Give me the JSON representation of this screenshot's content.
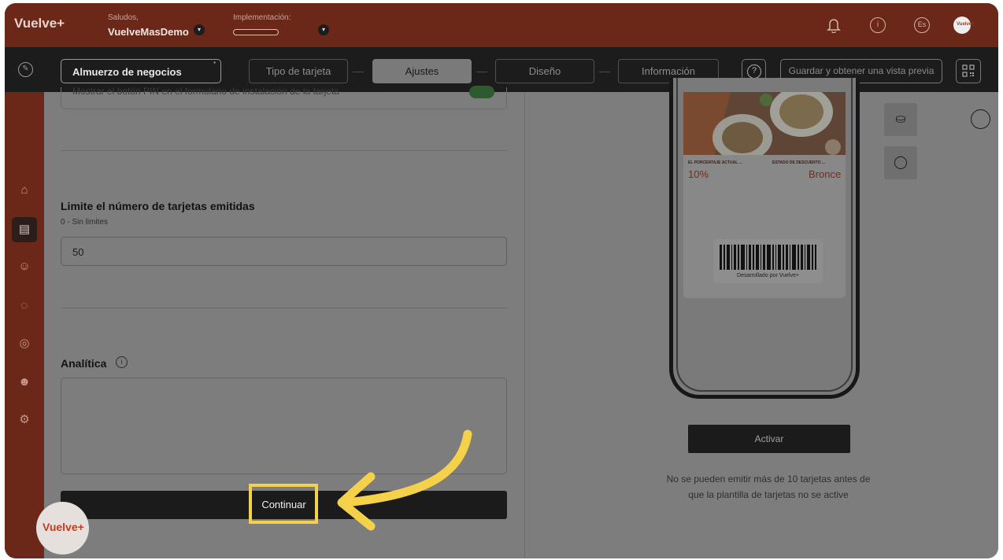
{
  "brand": {
    "logo_text": "Vuelve+"
  },
  "header": {
    "greeting_label": "Saludos,",
    "account_name": "VuelveMasDemo",
    "implementation_label": "Implementación:",
    "implementation_progress": 0,
    "language": "Es"
  },
  "toolbar": {
    "card_name": "Almuerzo de negocios",
    "steps": [
      {
        "label": "Tipo de tarjeta",
        "active": false
      },
      {
        "label": "Ajustes",
        "active": true
      },
      {
        "label": "Diseño",
        "active": false
      },
      {
        "label": "Información",
        "active": false
      }
    ],
    "help_label": "?",
    "save_label": "Guardar y obtener una vista previa"
  },
  "form": {
    "cut_off_text": "Mostrar el botón PIN en el formulario de instalación de la tarjeta",
    "limit_title": "Limite el número de tarjetas emitidas",
    "limit_hint": "0 - Sin limites",
    "limit_value": "50",
    "analytics_title": "Analítica",
    "continue_label": "Continuar"
  },
  "preview": {
    "field_left_label": "EL PORCENTAJE ACTUAL ...",
    "field_right_label": "ESTADO DE DESCUENTO ...",
    "field_left_value": "10%",
    "field_right_value": "Bronce",
    "barcode_caption": "Desarrollado por Vuelve+",
    "activate_label": "Activar",
    "note": "No se pueden emitir más de 10 tarjetas antes de que la plantilla de tarjetas no se active"
  },
  "colors": {
    "brand_dark": "#6b2718",
    "overlay_gray": "#7d7d7d",
    "highlight": "#f5d049"
  }
}
